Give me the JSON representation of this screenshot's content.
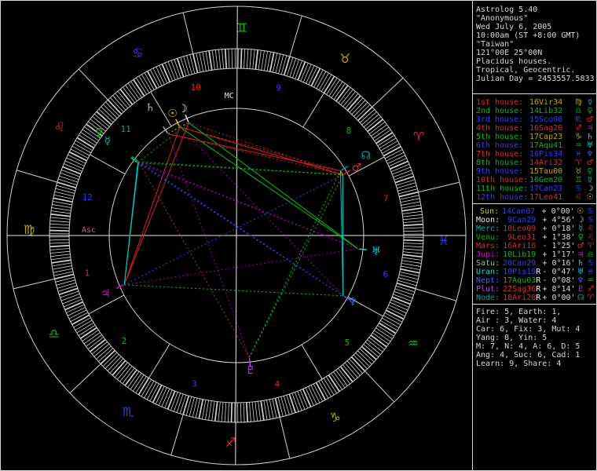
{
  "app": {
    "title": "Astrolog 5.40",
    "person": "\"Anonymous\"",
    "date": "Wed July 6, 2005",
    "time": "10:00am (ST +8:00 GMT)",
    "place": "\"Taiwan\"",
    "coords": "121°00E 25°00N",
    "house_system": "Placidus houses.",
    "zodiac_type": "Tropical, Geocentric.",
    "julian": "Julian Day = 2453557.5833"
  },
  "colors": {
    "bg": "#000000",
    "line": "#d0d0d0",
    "bright": "#f0f0f0",
    "text": "#d8d8d8",
    "fire": "#e02828",
    "earth": "#bcac00",
    "air": "#00c000",
    "water": "#3838ff",
    "angular": "#e02828",
    "succedent": "#00c000",
    "cadent": "#3838ff",
    "asc_label": "#c87030",
    "mc_label": "#e8e8e8",
    "planet": {
      "sun": "#e8c800",
      "moon": "#e8e8e8",
      "mercury": "#00b8b8",
      "venus": "#00b800",
      "mars": "#e02828",
      "jupiter": "#e000e0",
      "saturn": "#9ab8b8",
      "uranus": "#00e0e0",
      "neptune": "#4060ff",
      "pluto": "#b048e0",
      "node": "#00a0a0"
    },
    "aspect": {
      "con": "#c8c800",
      "ssx": "#008800",
      "ssq": "#a04800",
      "sex": "#00c8c8",
      "squ": "#d82020",
      "tri": "#00c800",
      "qcx": "#a800a8",
      "opp": "#3048ff"
    }
  },
  "signs": [
    {
      "name": "aries",
      "glyph": "♈",
      "element": "fire"
    },
    {
      "name": "taurus",
      "glyph": "♉",
      "element": "earth"
    },
    {
      "name": "gemini",
      "glyph": "♊",
      "element": "air"
    },
    {
      "name": "cancer",
      "glyph": "♋",
      "element": "water"
    },
    {
      "name": "leo",
      "glyph": "♌",
      "element": "fire"
    },
    {
      "name": "virgo",
      "glyph": "♍",
      "element": "earth"
    },
    {
      "name": "libra",
      "glyph": "♎",
      "element": "air"
    },
    {
      "name": "scorpio",
      "glyph": "♏",
      "element": "water"
    },
    {
      "name": "sagittarius",
      "glyph": "♐",
      "element": "fire"
    },
    {
      "name": "capricorn",
      "glyph": "♑",
      "element": "earth"
    },
    {
      "name": "aquarius",
      "glyph": "♒",
      "element": "air"
    },
    {
      "name": "pisces",
      "glyph": "♓",
      "element": "water"
    }
  ],
  "houses": [
    {
      "label": "1st house:",
      "value": "16Vir34",
      "lon": 166.567,
      "mode": "angular",
      "element": "earth",
      "sign_glyph": "♍",
      "ruler_glyph": "☿",
      "ruler_color": "mercury"
    },
    {
      "label": "2nd house:",
      "value": "14Lib32",
      "lon": 194.533,
      "mode": "succedent",
      "element": "air",
      "sign_glyph": "♎",
      "ruler_glyph": "♀",
      "ruler_color": "venus"
    },
    {
      "label": "3rd house:",
      "value": "15Sco00",
      "lon": 225.0,
      "mode": "cadent",
      "element": "water",
      "sign_glyph": "♏",
      "ruler_glyph": "♂",
      "ruler_color": "mars"
    },
    {
      "label": "4th house:",
      "value": "16Sag20",
      "lon": 256.333,
      "mode": "angular",
      "element": "fire",
      "sign_glyph": "♐",
      "ruler_glyph": "♃",
      "ruler_color": "jupiter"
    },
    {
      "label": "5th house:",
      "value": "17Cap23",
      "lon": 287.383,
      "mode": "succedent",
      "element": "earth",
      "sign_glyph": "♑",
      "ruler_glyph": "♄",
      "ruler_color": "saturn"
    },
    {
      "label": "6th house:",
      "value": "17Aqu41",
      "lon": 317.683,
      "mode": "cadent",
      "element": "air",
      "sign_glyph": "♒",
      "ruler_glyph": "♅",
      "ruler_color": "uranus"
    },
    {
      "label": "7th house:",
      "value": "16Pis34",
      "lon": 346.567,
      "mode": "angular",
      "element": "water",
      "sign_glyph": "♓",
      "ruler_glyph": "♆",
      "ruler_color": "neptune"
    },
    {
      "label": "8th house:",
      "value": "14Ari32",
      "lon": 14.533,
      "mode": "succedent",
      "element": "fire",
      "sign_glyph": "♈",
      "ruler_glyph": "♂",
      "ruler_color": "mars"
    },
    {
      "label": "9th house:",
      "value": "15Tau00",
      "lon": 45.0,
      "mode": "cadent",
      "element": "earth",
      "sign_glyph": "♉",
      "ruler_glyph": "♀",
      "ruler_color": "venus"
    },
    {
      "label": "10th house:",
      "value": "16Gem20",
      "lon": 76.333,
      "mode": "angular",
      "element": "air",
      "sign_glyph": "♊",
      "ruler_glyph": "☿",
      "ruler_color": "mercury"
    },
    {
      "label": "11th house:",
      "value": "17Can23",
      "lon": 107.383,
      "mode": "succedent",
      "element": "water",
      "sign_glyph": "♋",
      "ruler_glyph": "☽",
      "ruler_color": "moon"
    },
    {
      "label": "12th house:",
      "value": "17Leo41",
      "lon": 137.683,
      "mode": "cadent",
      "element": "fire",
      "sign_glyph": "♌",
      "ruler_glyph": "☉",
      "ruler_color": "sun"
    }
  ],
  "planets": [
    {
      "name": "sun",
      "label": "Sun:",
      "glyph": "☉",
      "value": "14Can07",
      "retro": "",
      "lat": "+ 0°00'",
      "lon": 104.117,
      "color": "sun",
      "sign_glyph": "♋",
      "element": "water",
      "r": 176
    },
    {
      "name": "moon",
      "label": "Moon:",
      "glyph": "☽",
      "value": " 9Can29",
      "retro": "",
      "lat": "+ 4°56'",
      "lon": 99.483,
      "color": "moon",
      "sign_glyph": "♋",
      "element": "water",
      "r": 176
    },
    {
      "name": "mercury",
      "label": "Merc:",
      "glyph": "☿",
      "value": "10Leo09",
      "retro": "",
      "lat": "+ 0°18'",
      "lon": 130.15,
      "color": "mercury",
      "sign_glyph": "♌",
      "element": "fire",
      "r": 204
    },
    {
      "name": "venus",
      "label": "Venu:",
      "glyph": "♀",
      "value": " 9Leo31",
      "retro": "",
      "lat": "+ 1°38'",
      "lon": 129.517,
      "color": "venus",
      "sign_glyph": "♌",
      "element": "fire",
      "r": 219
    },
    {
      "name": "mars",
      "label": "Mars:",
      "glyph": "♂",
      "value": "16Ari16",
      "retro": "",
      "lat": "- 1°25'",
      "lon": 16.267,
      "color": "mars",
      "sign_glyph": "♈",
      "element": "fire",
      "r": 176
    },
    {
      "name": "jupiter",
      "label": "Jupi:",
      "glyph": "♃",
      "value": "10Lib19",
      "retro": "",
      "lat": "+ 1°17'",
      "lon": 190.317,
      "color": "jupiter",
      "sign_glyph": "♎",
      "element": "air",
      "r": 182
    },
    {
      "name": "saturn",
      "label": "Satu:",
      "glyph": "♄",
      "value": "20Can29",
      "retro": "",
      "lat": "+ 0°16'",
      "lon": 110.483,
      "color": "saturn",
      "sign_glyph": "♋",
      "element": "water",
      "r": 197
    },
    {
      "name": "uranus",
      "label": "Uran:",
      "glyph": "♅",
      "value": "10Pis19",
      "retro": "R",
      "lat": "- 0°47'",
      "lon": 340.317,
      "color": "uranus",
      "sign_glyph": "♓",
      "element": "water",
      "r": 179
    },
    {
      "name": "neptune",
      "label": "Nept:",
      "glyph": "♆",
      "value": "17Aqu03",
      "retro": "R",
      "lat": "- 0°08'",
      "lon": 317.05,
      "color": "neptune",
      "sign_glyph": "♒",
      "element": "air",
      "r": 170
    },
    {
      "name": "pluto",
      "label": "Plut:",
      "glyph": "♇",
      "value": "22Sag36",
      "retro": "R",
      "lat": "+ 8°14'",
      "lon": 262.6,
      "color": "pluto",
      "sign_glyph": "♐",
      "element": "fire",
      "r": 172
    },
    {
      "name": "node",
      "label": "Node:",
      "glyph": "☊",
      "value": "18Ari28",
      "retro": "R",
      "lat": "+ 0°00'",
      "lon": 18.467,
      "color": "node",
      "sign_glyph": "♈",
      "element": "fire",
      "r": 194
    }
  ],
  "summary": [
    "Fire: 5, Earth: 1,",
    "Air : 3, Water: 4",
    "Car: 6, Fix: 3, Mut: 4",
    "Yang: 8, Yin: 5",
    "M: 7, N: 4, A: 6, D: 5",
    "Ang: 4, Suc: 6, Cad: 1",
    "Learn: 9, Share: 4"
  ],
  "wheel": {
    "asc_lon": 166.567,
    "asc_label": "Asc",
    "mc_label": "MC",
    "house_numbers": [
      "1",
      "2",
      "3",
      "4",
      "5",
      "6",
      "7",
      "8",
      "9",
      "10",
      "11",
      "12"
    ]
  }
}
